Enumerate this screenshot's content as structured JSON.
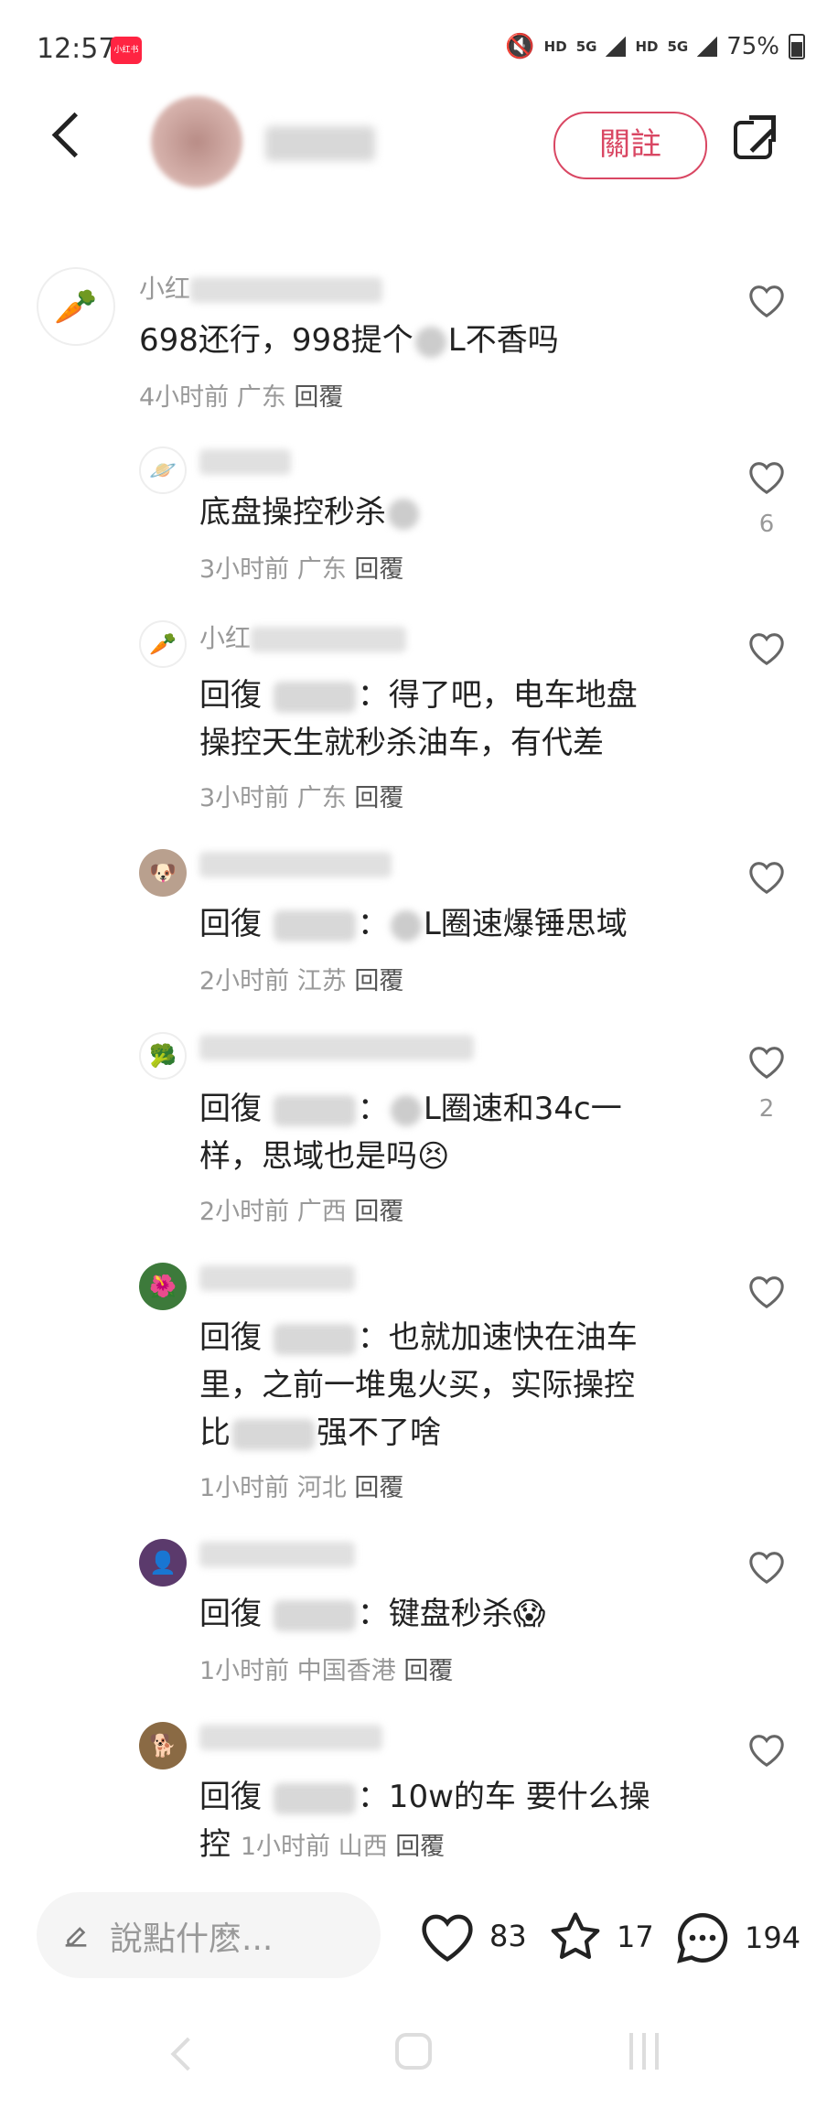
{
  "status": {
    "time": "12:57",
    "app_badge": "小红书",
    "hd1": "HD",
    "net1": "5G",
    "hd2": "HD",
    "net2": "5G",
    "battery": "75%"
  },
  "header": {
    "follow_label": "關註"
  },
  "comments": [
    {
      "avatar_icon": "carrot-icon",
      "user": "小红",
      "text_a": "698还行，998提个",
      "text_b": "L不香吗",
      "time": "4小时前",
      "region": "广东",
      "reply": "回覆",
      "likes": ""
    },
    {
      "avatar_icon": "planet-icon",
      "user": "",
      "text_a": "底盘操控秒杀",
      "text_b": "",
      "time": "3小时前",
      "region": "广东",
      "reply": "回覆",
      "likes": "6"
    },
    {
      "avatar_icon": "carrot-icon",
      "user": "小红",
      "prefix": "回復",
      "line1": "：得了吧，电车地盘",
      "line2": "操控天生就秒杀油车，有代差",
      "time": "3小时前",
      "region": "广东",
      "reply": "回覆",
      "likes": ""
    },
    {
      "avatar_icon": "dog-photo-icon",
      "user": "",
      "prefix": "回復",
      "line1": "：",
      "line1b": "L圈速爆锤思域",
      "time": "2小时前",
      "region": "江苏",
      "reply": "回覆",
      "likes": ""
    },
    {
      "avatar_icon": "broccoli-icon",
      "user": "",
      "prefix": "回復",
      "line1": "：",
      "line1b": "L圈速和34c一",
      "line2": "样，思域也是吗",
      "time": "2小时前",
      "region": "广西",
      "reply": "回覆",
      "likes": "2"
    },
    {
      "avatar_icon": "flower-photo-icon",
      "user": "",
      "prefix": "回復",
      "line1": "：也就加速快在油车",
      "line2": "里，之前一堆鬼火买，实际操控",
      "line3a": "比",
      "line3b": "强不了啥",
      "time": "1小时前",
      "region": "河北",
      "reply": "回覆",
      "likes": ""
    },
    {
      "avatar_icon": "anime-avatar-icon",
      "user": "",
      "prefix": "回復",
      "line1": "：键盘秒杀",
      "time": "1小时前",
      "region": "中国香港",
      "reply": "回覆",
      "likes": ""
    },
    {
      "avatar_icon": "dog-photo-icon",
      "user": "",
      "prefix": "回復",
      "line1": "：10w的车 要什么操",
      "line2": "控",
      "time": "1小时前",
      "region": "山西",
      "reply": "回覆",
      "likes": ""
    }
  ],
  "bottom": {
    "placeholder": "說點什麽...",
    "likes": "83",
    "stars": "17",
    "comments": "194"
  }
}
